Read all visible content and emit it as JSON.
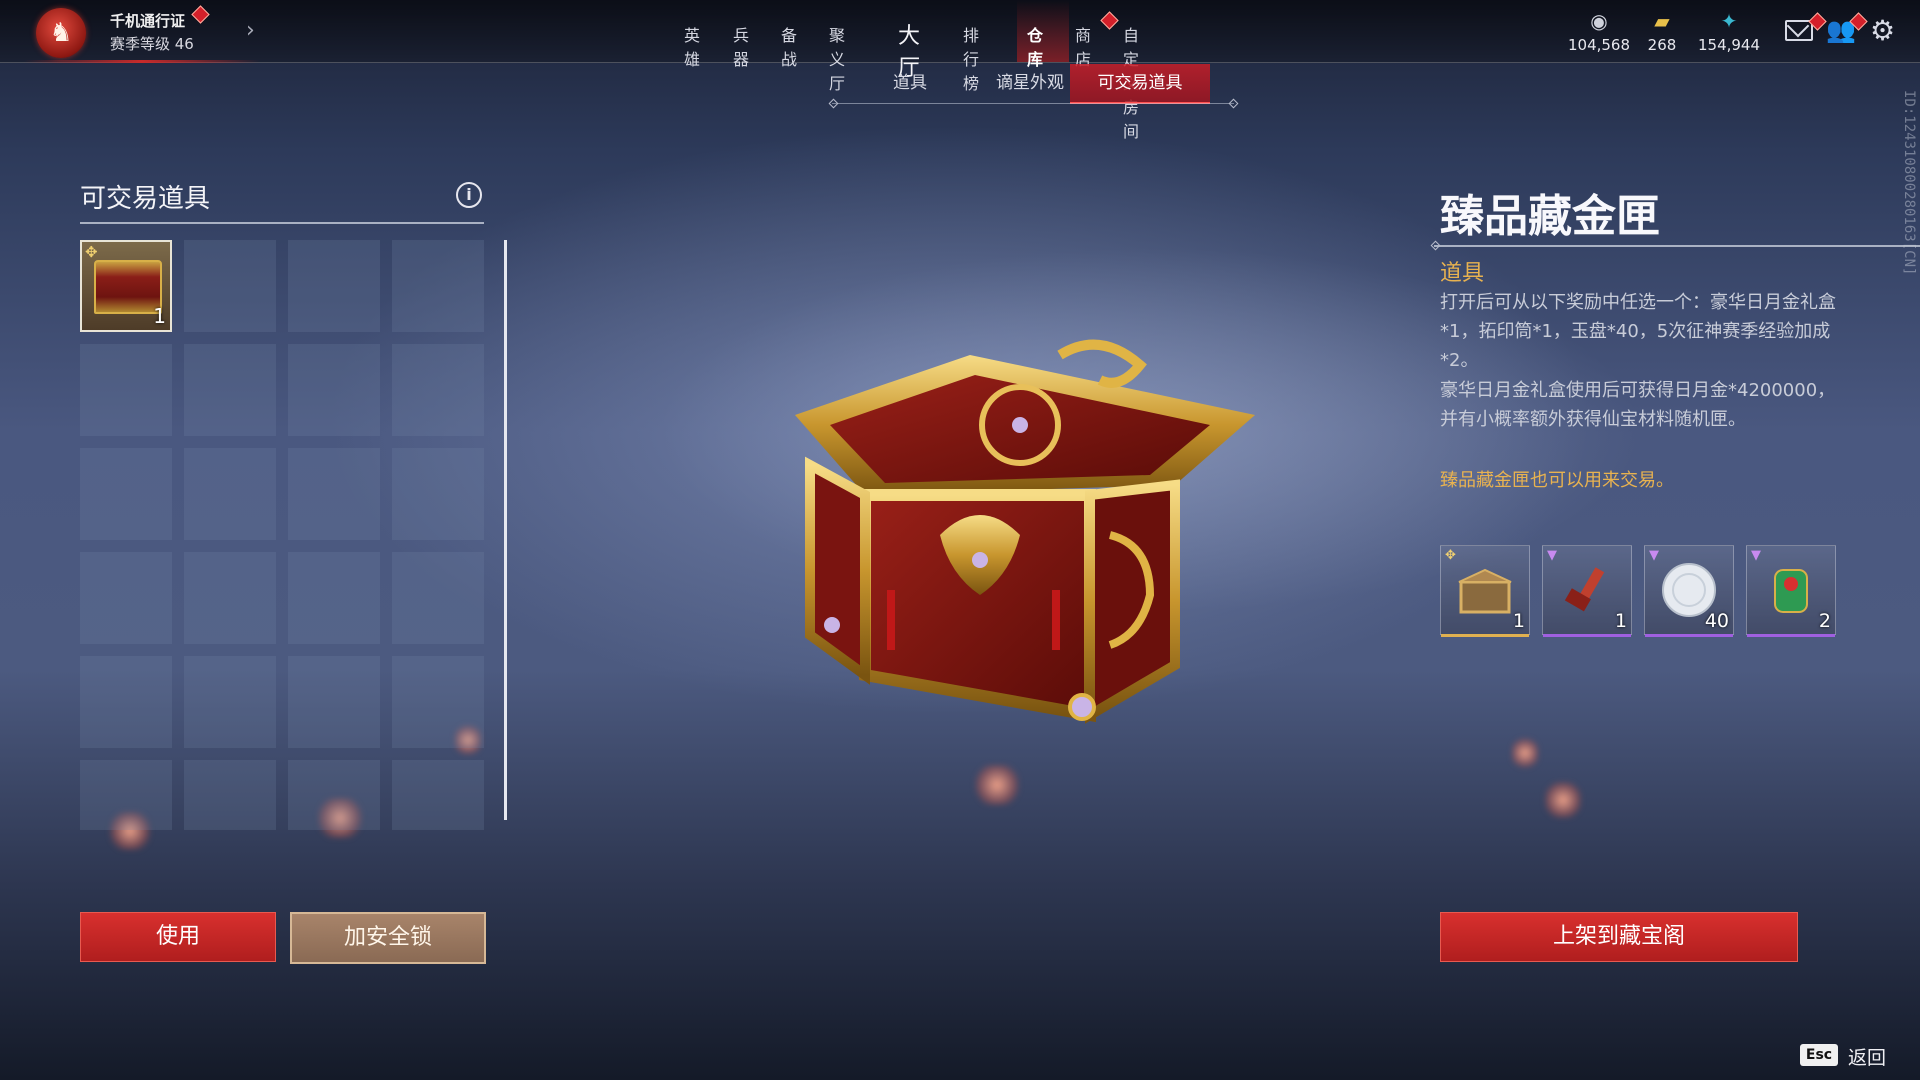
{
  "pass": {
    "title": "千机通行证",
    "level": "赛季等级 46",
    "arrow": "›"
  },
  "nav": {
    "items": [
      {
        "label": "英雄"
      },
      {
        "label": "兵器"
      },
      {
        "label": "备战"
      },
      {
        "label": "聚义厅"
      },
      {
        "label": "大厅"
      },
      {
        "label": "排行榜"
      },
      {
        "label": "仓库"
      },
      {
        "label": "商店"
      },
      {
        "label": "自定义房间"
      }
    ],
    "active": "仓库"
  },
  "currencies": [
    {
      "icon": "coin-stack-icon",
      "glyph": "◉",
      "value": "104,568",
      "color": "#cfd2dc"
    },
    {
      "icon": "gold-ticket-icon",
      "glyph": "▰",
      "value": "268",
      "color": "#e8c04a"
    },
    {
      "icon": "jade-feather-icon",
      "glyph": "✦",
      "value": "154,944",
      "color": "#3ab8d0"
    }
  ],
  "header_icons": {
    "mail": "mail-icon",
    "friends": "friends-icon",
    "settings": "gear-icon",
    "friends_glyph": "👥",
    "gear_glyph": "⚙"
  },
  "subtabs": [
    {
      "label": "道具"
    },
    {
      "label": "谪星外观"
    },
    {
      "label": "可交易道具"
    }
  ],
  "subtab_active": "可交易道具",
  "left_panel": {
    "title": "可交易道具",
    "info_glyph": "i",
    "selected_item": {
      "name": "臻品藏金匣",
      "count": "1",
      "quality_glyph": "✥"
    },
    "buttons": {
      "use": "使用",
      "lock": "加安全锁"
    }
  },
  "detail": {
    "title": "臻品藏金匣",
    "type": "道具",
    "desc1": "打开后可从以下奖励中任选一个：豪华日月金礼盒*1，拓印筒*1，玉盘*40，5次征神赛季经验加成*2。",
    "desc2": "豪华日月金礼盒使用后可获得日月金*4200000，并有小概率额外获得仙宝材料随机匣。",
    "note": "臻品藏金匣也可以用来交易。",
    "rewards": [
      {
        "icon": "deluxe-gift-box-icon",
        "count": "1",
        "quality": "gold",
        "bar_color": "#e0b050",
        "quality_glyph": "✥"
      },
      {
        "icon": "rubbing-tube-icon",
        "count": "1",
        "quality": "purple",
        "bar_color": "#a060e0",
        "quality_glyph": "▼"
      },
      {
        "icon": "jade-plate-icon",
        "count": "40",
        "quality": "purple",
        "bar_color": "#a060e0",
        "quality_glyph": "▼"
      },
      {
        "icon": "exp-boost-icon",
        "count": "2",
        "quality": "purple",
        "bar_color": "#a060e0",
        "quality_glyph": "▼"
      }
    ],
    "list_button": "上架到藏宝阁"
  },
  "side_id": "ID:1243108002801​63[CN]",
  "footer": {
    "esc_key": "Esc",
    "back": "返回"
  },
  "colors": {
    "accent_red": "#c82a2a",
    "gold_text": "#e8b250"
  }
}
